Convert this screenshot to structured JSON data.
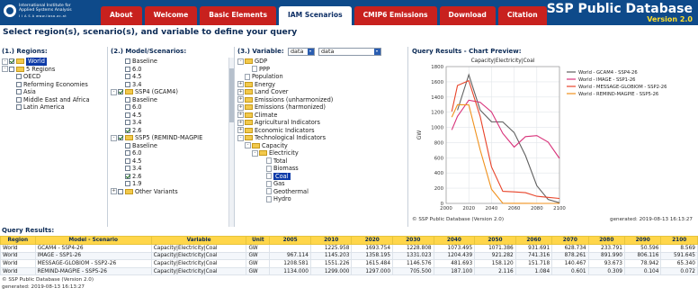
{
  "header": {
    "logo_text": "International Institute for Applied Systems Analysis",
    "logo_sub": "I I A S A  www.iiasa.ac.at",
    "tabs": [
      {
        "label": "About",
        "active": false
      },
      {
        "label": "Welcome",
        "active": false
      },
      {
        "label": "Basic Elements",
        "active": false
      },
      {
        "label": "IAM Scenarios",
        "active": true
      },
      {
        "label": "CMIP6 Emissions",
        "active": false
      },
      {
        "label": "Download",
        "active": false
      },
      {
        "label": "Citation",
        "active": false
      }
    ],
    "db_title": "SSP Public Database",
    "db_version": "Version 2.0"
  },
  "instruction": "Select region(s), scenario(s), and variable to define your query",
  "regions": {
    "title": "(1.) Regions:",
    "items": [
      {
        "label": "World",
        "checked": true,
        "selected": true,
        "indent": 0,
        "expander": "-",
        "folder": true
      },
      {
        "label": "5 Regions",
        "checked": false,
        "selected": false,
        "indent": 0,
        "expander": "-",
        "folder": true
      },
      {
        "label": "OECD",
        "checked": false,
        "indent": 1
      },
      {
        "label": "Reforming Economies",
        "checked": false,
        "indent": 1
      },
      {
        "label": "Asia",
        "checked": false,
        "indent": 1
      },
      {
        "label": "Middle East and Africa",
        "checked": false,
        "indent": 1
      },
      {
        "label": "Latin America",
        "checked": false,
        "indent": 1
      }
    ]
  },
  "models": {
    "title": "(2.) Model/Scenarios:",
    "items": [
      {
        "label": "Baseline",
        "checked": false,
        "indent": 1
      },
      {
        "label": "6.0",
        "checked": false,
        "indent": 1
      },
      {
        "label": "4.5",
        "checked": false,
        "indent": 1
      },
      {
        "label": "3.4",
        "checked": false,
        "indent": 1
      },
      {
        "label": "SSP4 (GCAM4)",
        "checked": true,
        "indent": 0,
        "expander": "-",
        "folder": true
      },
      {
        "label": "Baseline",
        "checked": false,
        "indent": 1
      },
      {
        "label": "6.0",
        "checked": false,
        "indent": 1
      },
      {
        "label": "4.5",
        "checked": false,
        "indent": 1
      },
      {
        "label": "3.4",
        "checked": false,
        "indent": 1
      },
      {
        "label": "2.6",
        "checked": true,
        "indent": 1
      },
      {
        "label": "SSP5 (REMIND-MAGPIE",
        "checked": true,
        "indent": 0,
        "expander": "-",
        "folder": true
      },
      {
        "label": "Baseline",
        "checked": false,
        "indent": 1
      },
      {
        "label": "6.0",
        "checked": false,
        "indent": 1
      },
      {
        "label": "4.5",
        "checked": false,
        "indent": 1
      },
      {
        "label": "3.4",
        "checked": false,
        "indent": 1
      },
      {
        "label": "2.6",
        "checked": true,
        "indent": 1
      },
      {
        "label": "1.9",
        "checked": false,
        "indent": 1
      },
      {
        "label": "Other Variants",
        "checked": false,
        "indent": 0,
        "expander": "+",
        "folder": true
      }
    ]
  },
  "variables": {
    "title": "(3.) Variable:",
    "dropdown1": "data",
    "dropdown2": "data",
    "items": [
      {
        "label": "GDP",
        "indent": 0,
        "expander": "-",
        "folder": true
      },
      {
        "label": "PPP",
        "indent": 1,
        "doc": true
      },
      {
        "label": "Population",
        "indent": 0,
        "doc": true
      },
      {
        "label": "Energy",
        "indent": 0,
        "expander": "+",
        "folder": true
      },
      {
        "label": "Land Cover",
        "indent": 0,
        "expander": "+",
        "folder": true
      },
      {
        "label": "Emissions (unharmonized)",
        "indent": 0,
        "expander": "+",
        "folder": true
      },
      {
        "label": "Emissions (harmonized)",
        "indent": 0,
        "expander": "+",
        "folder": true
      },
      {
        "label": "Climate",
        "indent": 0,
        "expander": "+",
        "folder": true
      },
      {
        "label": "Agricultural Indicators",
        "indent": 0,
        "expander": "+",
        "folder": true
      },
      {
        "label": "Economic Indicators",
        "indent": 0,
        "expander": "+",
        "folder": true
      },
      {
        "label": "Technological Indicators",
        "indent": 0,
        "expander": "-",
        "folder": true
      },
      {
        "label": "Capacity",
        "indent": 1,
        "expander": "-",
        "folder": true
      },
      {
        "label": "Electricity",
        "indent": 2,
        "expander": "-",
        "folder": true
      },
      {
        "label": "Total",
        "indent": 3,
        "doc": true
      },
      {
        "label": "Biomass",
        "indent": 3,
        "doc": true
      },
      {
        "label": "Coal",
        "indent": 3,
        "doc": true,
        "selected": true
      },
      {
        "label": "Gas",
        "indent": 3,
        "doc": true
      },
      {
        "label": "Geothermal",
        "indent": 3,
        "doc": true
      },
      {
        "label": "Hydro",
        "indent": 3,
        "doc": true
      }
    ]
  },
  "chart_panel": {
    "title": "Query Results - Chart Preview:",
    "source": "© SSP Public Database (Version 2.0)",
    "generated": "generated: 2019-08-13 16:13:27"
  },
  "chart_data": {
    "type": "line",
    "title": "Capacity|Electricity|Coal",
    "ylabel": "GW",
    "xlim": [
      2000,
      2100
    ],
    "ylim": [
      0,
      1800
    ],
    "xticks": [
      2000,
      2020,
      2040,
      2060,
      2080,
      2100
    ],
    "yticks": [
      0,
      200,
      400,
      600,
      800,
      1000,
      1200,
      1400,
      1600,
      1800
    ],
    "x": [
      2005,
      2010,
      2020,
      2030,
      2040,
      2050,
      2060,
      2070,
      2080,
      2090,
      2100
    ],
    "legend_position": "top-right",
    "series": [
      {
        "name": "World - GCAM4 - SSP4-26",
        "color": "#606060",
        "values": [
          null,
          1225.958,
          1693.754,
          1228.808,
          1073.495,
          1071.386,
          931.691,
          628.734,
          233.791,
          50.596,
          8.569
        ]
      },
      {
        "name": "World - IMAGE - SSP1-26",
        "color": "#d8327a",
        "values": [
          967.114,
          1145.203,
          1358.195,
          1331.023,
          1204.439,
          921.282,
          741.316,
          878.261,
          891.99,
          806.116,
          591.645
        ]
      },
      {
        "name": "World - MESSAGE-GLOBIOM - SSP2-26",
        "color": "#e8442a",
        "values": [
          1208.581,
          1551.226,
          1615.484,
          1146.576,
          481.693,
          158.12,
          151.718,
          140.467,
          93.673,
          78.942,
          65.34
        ]
      },
      {
        "name": "World - REMIND-MAGPIE - SSP5-26",
        "color": "#f0911c",
        "values": [
          1134.0,
          1299.0,
          1297.0,
          705.5,
          187.1,
          2.116,
          1.084,
          0.601,
          0.309,
          0.104,
          0.072
        ]
      }
    ]
  },
  "results": {
    "title": "Query Results:",
    "columns": [
      "Region",
      "Model - Scenario",
      "Variable",
      "Unit",
      "2005",
      "2010",
      "2020",
      "2030",
      "2040",
      "2050",
      "2060",
      "2070",
      "2080",
      "2090",
      "2100"
    ],
    "rows": [
      [
        "World",
        "GCAM4 - SSP4-26",
        "Capacity|Electricity|Coal",
        "GW",
        "",
        "1225.958",
        "1693.754",
        "1228.808",
        "1073.495",
        "1071.386",
        "931.691",
        "628.734",
        "233.791",
        "50.596",
        "8.569"
      ],
      [
        "World",
        "IMAGE - SSP1-26",
        "Capacity|Electricity|Coal",
        "GW",
        "967.114",
        "1145.203",
        "1358.195",
        "1331.023",
        "1204.439",
        "921.282",
        "741.316",
        "878.261",
        "891.990",
        "806.116",
        "591.645"
      ],
      [
        "World",
        "MESSAGE-GLOBIOM - SSP2-26",
        "Capacity|Electricity|Coal",
        "GW",
        "1208.581",
        "1551.226",
        "1615.484",
        "1146.576",
        "481.693",
        "158.120",
        "151.718",
        "140.467",
        "93.673",
        "78.942",
        "65.340"
      ],
      [
        "World",
        "REMIND-MAGPIE - SSP5-26",
        "Capacity|Electricity|Coal",
        "GW",
        "1134.000",
        "1299.000",
        "1297.000",
        "705.500",
        "187.100",
        "2.116",
        "1.084",
        "0.601",
        "0.309",
        "0.104",
        "0.072"
      ]
    ],
    "footer1": "© SSP Public Database (Version 2.0)",
    "footer2": "generated: 2019-08-13 16:13:27"
  }
}
